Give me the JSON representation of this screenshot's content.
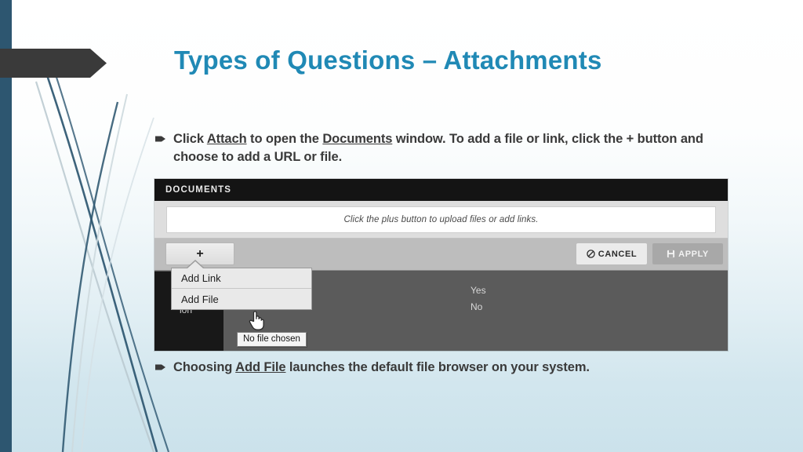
{
  "slide": {
    "title": "Types of Questions – Attachments",
    "title_color": "#2089b5",
    "background_top_color": "#ffffff",
    "background_bottom_color": "#cbe2eb",
    "accent_bar_color": "#2d5670",
    "banner_color": "#3a3a3a"
  },
  "bullets": [
    {
      "marker": "arrow-bullet-icon",
      "segments": [
        {
          "text": "Click ",
          "underline": false
        },
        {
          "text": "Attach",
          "underline": true
        },
        {
          "text": " to open the ",
          "underline": false
        },
        {
          "text": "Documents",
          "underline": true
        },
        {
          "text": " window. To add a file or link, click the + button and choose to add a URL or file.",
          "underline": false
        }
      ]
    },
    {
      "marker": "arrow-bullet-icon",
      "segments": [
        {
          "text": "Choosing ",
          "underline": false
        },
        {
          "text": "Add File",
          "underline": true
        },
        {
          "text": " launches the default file browser on your system.",
          "underline": false
        }
      ]
    }
  ],
  "app_screenshot": {
    "window_title": "DOCUMENTS",
    "dropzone_text": "Click the plus button to upload files or add links.",
    "toolbar": {
      "plus_label": "+",
      "cancel_label": "CANCEL",
      "cancel_icon": "no-entry-icon",
      "apply_label": "APPLY",
      "apply_icon": "save-disk-icon"
    },
    "add_menu": {
      "items": [
        {
          "label": "Add Link"
        },
        {
          "label": "Add File"
        }
      ]
    },
    "tooltip_text": "No file chosen",
    "background_fragments": {
      "left_panel_text": "ion",
      "option_yes": "Yes",
      "option_no": "No"
    },
    "cursor": "hand-pointer-cursor"
  }
}
